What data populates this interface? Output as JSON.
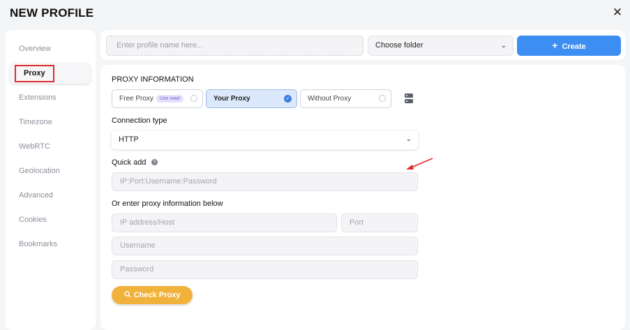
{
  "header": {
    "title": "NEW PROFILE",
    "close_glyph": "✕"
  },
  "sidebar": {
    "items": [
      {
        "label": "Overview"
      },
      {
        "label": "Proxy",
        "active": true
      },
      {
        "label": "Extensions"
      },
      {
        "label": "Timezone"
      },
      {
        "label": "WebRTC"
      },
      {
        "label": "Geolocation"
      },
      {
        "label": "Advanced"
      },
      {
        "label": "Cookies"
      },
      {
        "label": "Bookmarks"
      }
    ]
  },
  "topbar": {
    "name_placeholder": "Enter profile name here...",
    "folder_value": "Choose folder",
    "create_label": "Create",
    "create_glyph": "+"
  },
  "proxy": {
    "section_title": "PROXY INFORMATION",
    "options": [
      {
        "label": "Free Proxy",
        "badge": "Use now!",
        "selected": false
      },
      {
        "label": "Your Proxy",
        "selected": true
      },
      {
        "label": "Without Proxy",
        "selected": false
      }
    ],
    "connection_label": "Connection type",
    "connection_value": "HTTP",
    "quick_add_label": "Quick add",
    "quick_add_placeholder": "IP:Port:Username:Password",
    "manual_label": "Or enter proxy information below",
    "host_placeholder": "IP address/Host",
    "port_placeholder": "Port",
    "username_placeholder": "Username",
    "password_placeholder": "Password",
    "check_label": "Check Proxy"
  },
  "colors": {
    "accent": "#3d8ef2",
    "check_button": "#f0b23b",
    "highlight": "#e02a2a",
    "selected_option": "#dce8fb"
  },
  "icons": [
    "close-icon",
    "chevron-down-icon",
    "plus-icon",
    "server-list-icon",
    "help-icon",
    "search-icon",
    "check-icon",
    "arrow-annotation-icon"
  ]
}
